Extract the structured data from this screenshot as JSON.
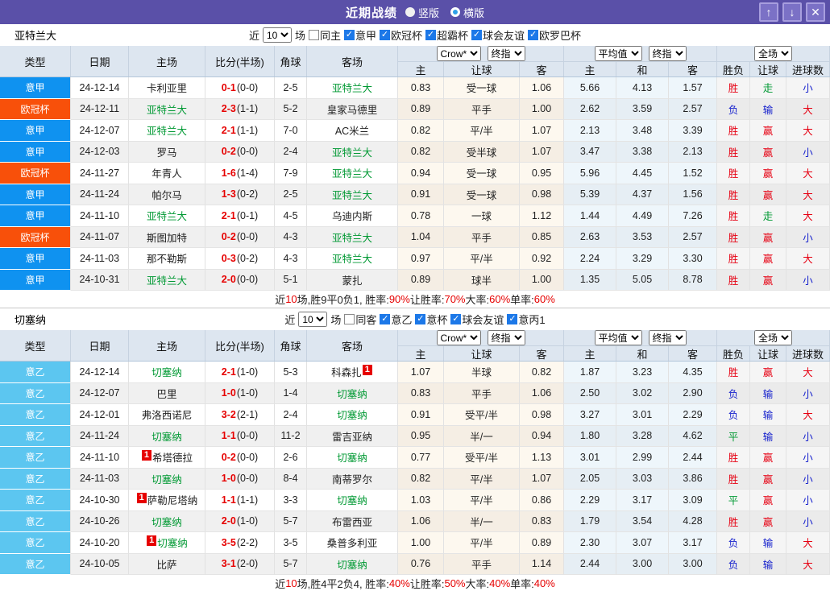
{
  "titlebar": {
    "title": "近期战绩",
    "radios": [
      {
        "label": "竖版",
        "style": "solid"
      },
      {
        "label": "横版",
        "style": "ring"
      }
    ],
    "buttons": [
      {
        "name": "move-up-button",
        "glyph": "↑"
      },
      {
        "name": "move-down-button",
        "glyph": "↓"
      },
      {
        "name": "close-button",
        "glyph": "✕"
      }
    ]
  },
  "header": {
    "left_cols": [
      "类型",
      "日期",
      "主场",
      "比分(半场)",
      "角球",
      "客场"
    ],
    "dropdowns": {
      "book": "Crow*",
      "book_final": "终指",
      "avg": "平均值",
      "avg_final": "终指",
      "scope": "全场"
    },
    "sub_cols": [
      "主",
      "让球",
      "客",
      "主",
      "和",
      "客",
      "胜负",
      "让球",
      "进球数"
    ]
  },
  "filter_text": {
    "prefix": "近",
    "suffix": "场",
    "count": "10"
  },
  "colors": {
    "titlebar_bg": "#5a50a8",
    "league": {
      "意甲": "#0f92f0",
      "欧冠杯": "#f8500a",
      "意乙": "#5cc6f0"
    },
    "result": {
      "胜": "#e60012",
      "赢": "#e60012",
      "大": "#e60012",
      "负": "#1722cd",
      "输": "#1722cd",
      "小": "#1722cd",
      "平": "#009933",
      "走": "#009933"
    },
    "team_green": "#009933",
    "score_red": "#e60000"
  },
  "sections": [
    {
      "team": "亚特兰大",
      "checkboxes": [
        {
          "label": "同主",
          "checked": false
        },
        {
          "label": "意甲",
          "checked": true
        },
        {
          "label": "欧冠杯",
          "checked": true
        },
        {
          "label": "超霸杯",
          "checked": true
        },
        {
          "label": "球会友谊",
          "checked": true
        },
        {
          "label": "欧罗巴杯",
          "checked": true
        }
      ],
      "rows": [
        {
          "type": "意甲",
          "date": "24-12-14",
          "home": {
            "name": "卡利亚里"
          },
          "ft": "0-1",
          "ht": "(0-0)",
          "corner": "2-5",
          "away": {
            "name": "亚特兰大",
            "green": true
          },
          "odds": [
            "0.83",
            "受一球",
            "1.06",
            "5.66",
            "4.13",
            "1.57"
          ],
          "res": [
            "胜",
            "走",
            "小"
          ]
        },
        {
          "type": "欧冠杯",
          "date": "24-12-11",
          "home": {
            "name": "亚特兰大",
            "green": true
          },
          "ft": "2-3",
          "ht": "(1-1)",
          "corner": "5-2",
          "away": {
            "name": "皇家马德里"
          },
          "odds": [
            "0.89",
            "平手",
            "1.00",
            "2.62",
            "3.59",
            "2.57"
          ],
          "res": [
            "负",
            "输",
            "大"
          ]
        },
        {
          "type": "意甲",
          "date": "24-12-07",
          "home": {
            "name": "亚特兰大",
            "green": true
          },
          "ft": "2-1",
          "ht": "(1-1)",
          "corner": "7-0",
          "away": {
            "name": "AC米兰"
          },
          "odds": [
            "0.82",
            "平/半",
            "1.07",
            "2.13",
            "3.48",
            "3.39"
          ],
          "res": [
            "胜",
            "赢",
            "大"
          ]
        },
        {
          "type": "意甲",
          "date": "24-12-03",
          "home": {
            "name": "罗马"
          },
          "ft": "0-2",
          "ht": "(0-0)",
          "corner": "2-4",
          "away": {
            "name": "亚特兰大",
            "green": true
          },
          "odds": [
            "0.82",
            "受半球",
            "1.07",
            "3.47",
            "3.38",
            "2.13"
          ],
          "res": [
            "胜",
            "赢",
            "小"
          ]
        },
        {
          "type": "欧冠杯",
          "date": "24-11-27",
          "home": {
            "name": "年青人"
          },
          "ft": "1-6",
          "ht": "(1-4)",
          "corner": "7-9",
          "away": {
            "name": "亚特兰大",
            "green": true
          },
          "odds": [
            "0.94",
            "受一球",
            "0.95",
            "5.96",
            "4.45",
            "1.52"
          ],
          "res": [
            "胜",
            "赢",
            "大"
          ]
        },
        {
          "type": "意甲",
          "date": "24-11-24",
          "home": {
            "name": "帕尔马"
          },
          "ft": "1-3",
          "ht": "(0-2)",
          "corner": "2-5",
          "away": {
            "name": "亚特兰大",
            "green": true
          },
          "odds": [
            "0.91",
            "受一球",
            "0.98",
            "5.39",
            "4.37",
            "1.56"
          ],
          "res": [
            "胜",
            "赢",
            "大"
          ]
        },
        {
          "type": "意甲",
          "date": "24-11-10",
          "home": {
            "name": "亚特兰大",
            "green": true
          },
          "ft": "2-1",
          "ht": "(0-1)",
          "corner": "4-5",
          "away": {
            "name": "乌迪内斯"
          },
          "odds": [
            "0.78",
            "一球",
            "1.12",
            "1.44",
            "4.49",
            "7.26"
          ],
          "res": [
            "胜",
            "走",
            "大"
          ]
        },
        {
          "type": "欧冠杯",
          "date": "24-11-07",
          "home": {
            "name": "斯图加特"
          },
          "ft": "0-2",
          "ht": "(0-0)",
          "corner": "4-3",
          "away": {
            "name": "亚特兰大",
            "green": true
          },
          "odds": [
            "1.04",
            "平手",
            "0.85",
            "2.63",
            "3.53",
            "2.57"
          ],
          "res": [
            "胜",
            "赢",
            "小"
          ]
        },
        {
          "type": "意甲",
          "date": "24-11-03",
          "home": {
            "name": "那不勒斯"
          },
          "ft": "0-3",
          "ht": "(0-2)",
          "corner": "4-3",
          "away": {
            "name": "亚特兰大",
            "green": true
          },
          "odds": [
            "0.97",
            "平/半",
            "0.92",
            "2.24",
            "3.29",
            "3.30"
          ],
          "res": [
            "胜",
            "赢",
            "大"
          ]
        },
        {
          "type": "意甲",
          "date": "24-10-31",
          "home": {
            "name": "亚特兰大",
            "green": true
          },
          "ft": "2-0",
          "ht": "(0-0)",
          "corner": "5-1",
          "away": {
            "name": "蒙扎"
          },
          "odds": [
            "0.89",
            "球半",
            "1.00",
            "1.35",
            "5.05",
            "8.78"
          ],
          "res": [
            "胜",
            "赢",
            "小"
          ]
        }
      ],
      "summary": [
        {
          "t": "近",
          "red": false
        },
        {
          "t": "10",
          "red": true
        },
        {
          "t": "场,胜9平0负1, 胜率:",
          "red": false
        },
        {
          "t": "90%",
          "red": true
        },
        {
          "t": " 让胜率:",
          "red": false
        },
        {
          "t": "70%",
          "red": true
        },
        {
          "t": " 大率:",
          "red": false
        },
        {
          "t": "60%",
          "red": true
        },
        {
          "t": " 单率:",
          "red": false
        },
        {
          "t": "60%",
          "red": true
        }
      ]
    },
    {
      "team": "切塞纳",
      "checkboxes": [
        {
          "label": "同客",
          "checked": false
        },
        {
          "label": "意乙",
          "checked": true
        },
        {
          "label": "意杯",
          "checked": true
        },
        {
          "label": "球会友谊",
          "checked": true
        },
        {
          "label": "意丙1",
          "checked": true
        }
      ],
      "rows": [
        {
          "type": "意乙",
          "date": "24-12-14",
          "home": {
            "name": "切塞纳",
            "green": true
          },
          "ft": "2-1",
          "ht": "(1-0)",
          "corner": "5-3",
          "away": {
            "name": "科森扎",
            "badge": "1",
            "badge_pos": "after"
          },
          "odds": [
            "1.07",
            "半球",
            "0.82",
            "1.87",
            "3.23",
            "4.35"
          ],
          "res": [
            "胜",
            "赢",
            "大"
          ]
        },
        {
          "type": "意乙",
          "date": "24-12-07",
          "home": {
            "name": "巴里"
          },
          "ft": "1-0",
          "ht": "(1-0)",
          "corner": "1-4",
          "away": {
            "name": "切塞纳",
            "green": true
          },
          "odds": [
            "0.83",
            "平手",
            "1.06",
            "2.50",
            "3.02",
            "2.90"
          ],
          "res": [
            "负",
            "输",
            "小"
          ]
        },
        {
          "type": "意乙",
          "date": "24-12-01",
          "home": {
            "name": "弗洛西诺尼"
          },
          "ft": "3-2",
          "ht": "(2-1)",
          "corner": "2-4",
          "away": {
            "name": "切塞纳",
            "green": true
          },
          "odds": [
            "0.91",
            "受平/半",
            "0.98",
            "3.27",
            "3.01",
            "2.29"
          ],
          "res": [
            "负",
            "输",
            "大"
          ]
        },
        {
          "type": "意乙",
          "date": "24-11-24",
          "home": {
            "name": "切塞纳",
            "green": true
          },
          "ft": "1-1",
          "ht": "(0-0)",
          "corner": "11-2",
          "away": {
            "name": "雷吉亚纳"
          },
          "odds": [
            "0.95",
            "半/一",
            "0.94",
            "1.80",
            "3.28",
            "4.62"
          ],
          "res": [
            "平",
            "输",
            "小"
          ]
        },
        {
          "type": "意乙",
          "date": "24-11-10",
          "home": {
            "name": "希塔德拉",
            "badge": "1",
            "badge_pos": "before"
          },
          "ft": "0-2",
          "ht": "(0-0)",
          "corner": "2-6",
          "away": {
            "name": "切塞纳",
            "green": true
          },
          "odds": [
            "0.77",
            "受平/半",
            "1.13",
            "3.01",
            "2.99",
            "2.44"
          ],
          "res": [
            "胜",
            "赢",
            "小"
          ]
        },
        {
          "type": "意乙",
          "date": "24-11-03",
          "home": {
            "name": "切塞纳",
            "green": true
          },
          "ft": "1-0",
          "ht": "(0-0)",
          "corner": "8-4",
          "away": {
            "name": "南蒂罗尔"
          },
          "odds": [
            "0.82",
            "平/半",
            "1.07",
            "2.05",
            "3.03",
            "3.86"
          ],
          "res": [
            "胜",
            "赢",
            "小"
          ]
        },
        {
          "type": "意乙",
          "date": "24-10-30",
          "home": {
            "name": "萨勒尼塔纳",
            "badge": "1",
            "badge_pos": "before"
          },
          "ft": "1-1",
          "ht": "(1-1)",
          "corner": "3-3",
          "away": {
            "name": "切塞纳",
            "green": true
          },
          "odds": [
            "1.03",
            "平/半",
            "0.86",
            "2.29",
            "3.17",
            "3.09"
          ],
          "res": [
            "平",
            "赢",
            "小"
          ]
        },
        {
          "type": "意乙",
          "date": "24-10-26",
          "home": {
            "name": "切塞纳",
            "green": true
          },
          "ft": "2-0",
          "ht": "(1-0)",
          "corner": "5-7",
          "away": {
            "name": "布雷西亚"
          },
          "odds": [
            "1.06",
            "半/一",
            "0.83",
            "1.79",
            "3.54",
            "4.28"
          ],
          "res": [
            "胜",
            "赢",
            "小"
          ]
        },
        {
          "type": "意乙",
          "date": "24-10-20",
          "home": {
            "name": "切塞纳",
            "green": true,
            "badge": "1",
            "badge_pos": "before"
          },
          "ft": "3-5",
          "ht": "(2-2)",
          "corner": "3-5",
          "away": {
            "name": "桑普多利亚"
          },
          "odds": [
            "1.00",
            "平/半",
            "0.89",
            "2.30",
            "3.07",
            "3.17"
          ],
          "res": [
            "负",
            "输",
            "大"
          ]
        },
        {
          "type": "意乙",
          "date": "24-10-05",
          "home": {
            "name": "比萨"
          },
          "ft": "3-1",
          "ht": "(2-0)",
          "corner": "5-7",
          "away": {
            "name": "切塞纳",
            "green": true
          },
          "odds": [
            "0.76",
            "平手",
            "1.14",
            "2.44",
            "3.00",
            "3.00"
          ],
          "res": [
            "负",
            "输",
            "大"
          ]
        }
      ],
      "summary": [
        {
          "t": "近",
          "red": false
        },
        {
          "t": "10",
          "red": true
        },
        {
          "t": "场,胜4平2负4, 胜率:",
          "red": false
        },
        {
          "t": "40%",
          "red": true
        },
        {
          "t": " 让胜率:",
          "red": false
        },
        {
          "t": "50%",
          "red": true
        },
        {
          "t": " 大率:",
          "red": false
        },
        {
          "t": "40%",
          "red": true
        },
        {
          "t": " 单率:",
          "red": false
        },
        {
          "t": "40%",
          "red": true
        }
      ]
    }
  ]
}
